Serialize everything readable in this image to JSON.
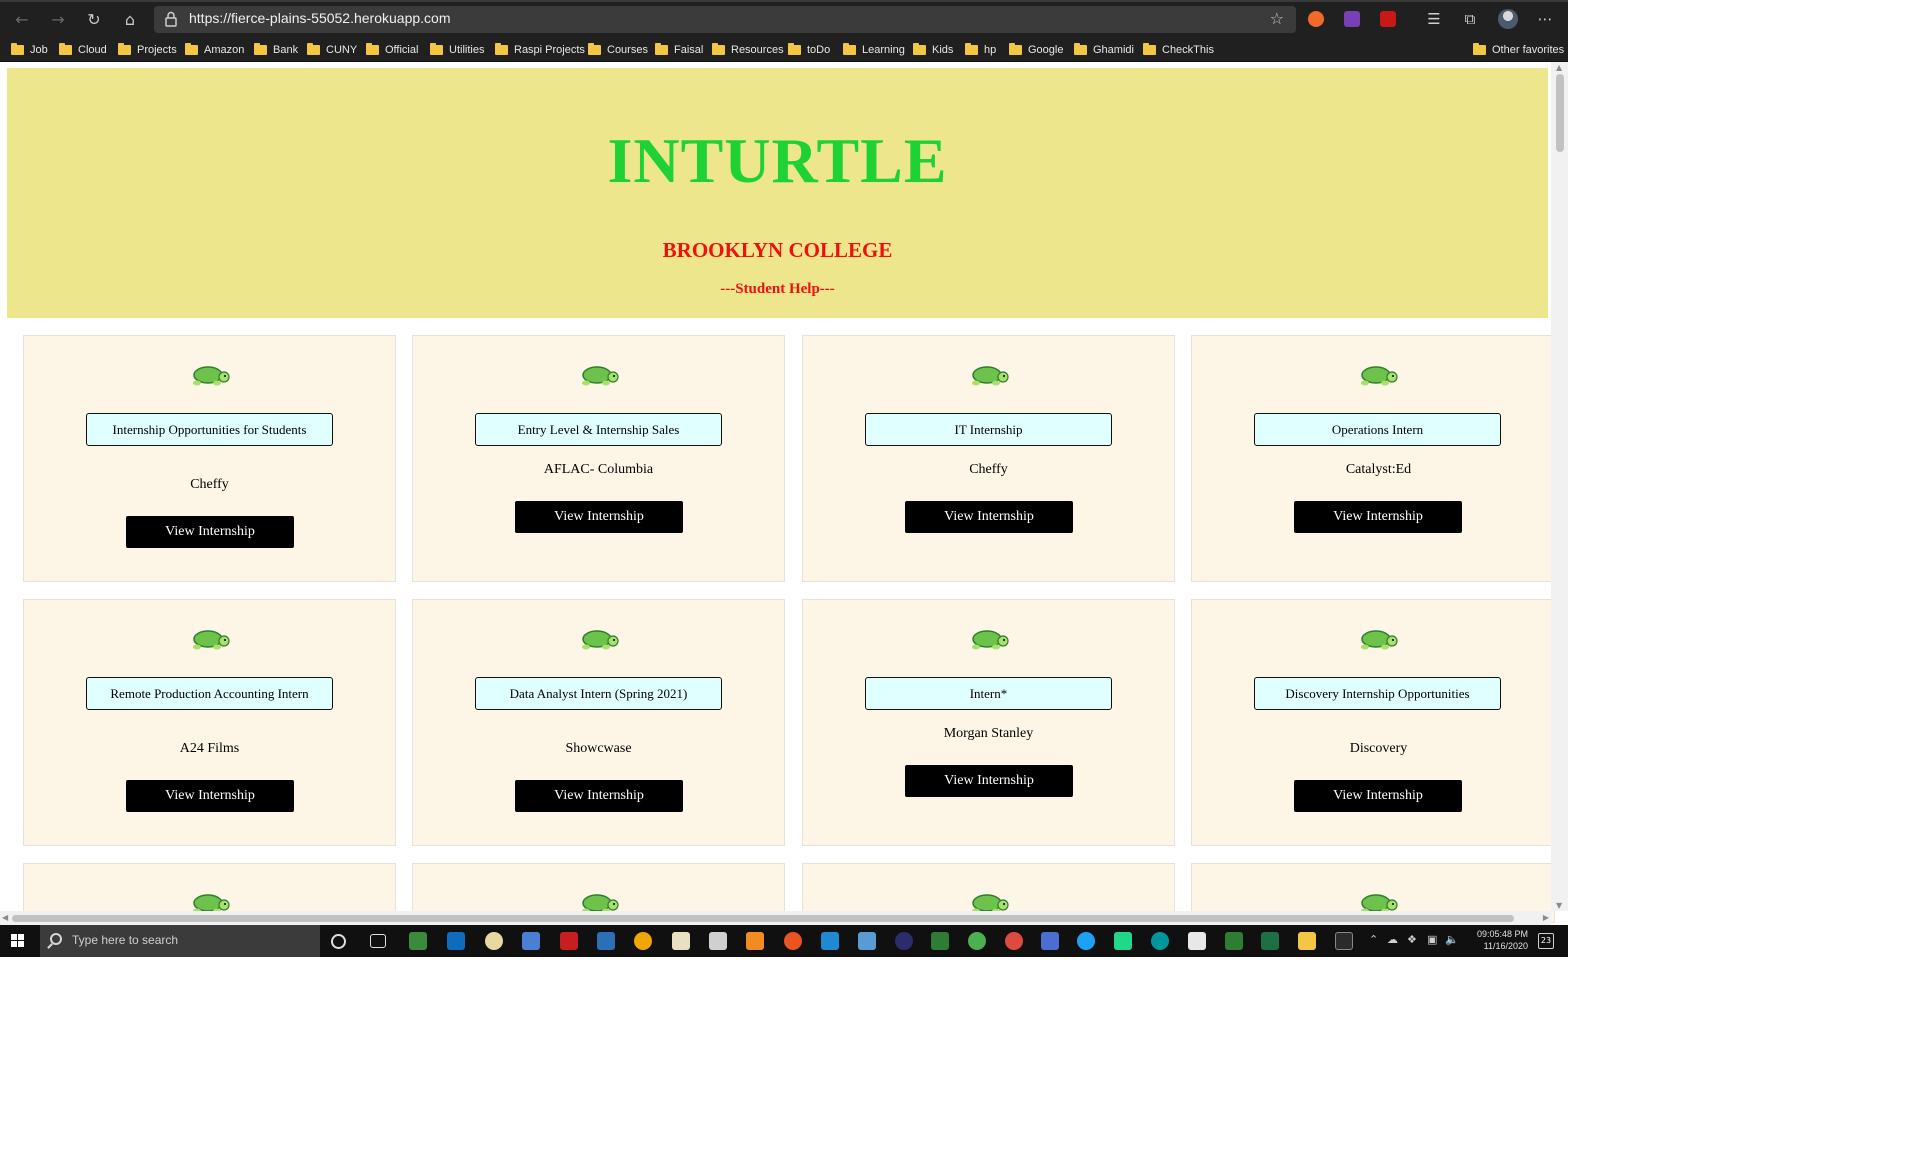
{
  "browser": {
    "url": "https://fierce-plains-55052.herokuapp.com",
    "bookmarks": [
      "Job",
      "Cloud",
      "Projects",
      "Amazon",
      "Bank",
      "CUNY",
      "Official",
      "Utilities",
      "Raspi Projects",
      "Courses",
      "Faisal",
      "Resources",
      "toDo",
      "Learning",
      "Kids",
      "hp",
      "Google",
      "Ghamidi",
      "CheckThis"
    ],
    "other_favorites": "Other favorites"
  },
  "page": {
    "title": "INTURTLE",
    "subtitle": "BROOKLYN COLLEGE",
    "tagline": "---Student Help---",
    "title_color": "#1ed235",
    "subtitle_color": "#ee1111",
    "header_bg": "#eee68c",
    "card_bg": "#fdf5e6",
    "title_box_bg": "#e0ffff",
    "button_label": "View Internship"
  },
  "cards": [
    {
      "title": "Internship Opportunities for Students",
      "company": "Cheffy"
    },
    {
      "title": "Entry Level & Internship Sales",
      "company": "AFLAC- Columbia"
    },
    {
      "title": "IT Internship",
      "company": "Cheffy"
    },
    {
      "title": "Operations Intern",
      "company": "Catalyst:Ed"
    },
    {
      "title": "Remote Production Accounting Intern",
      "company": "A24 Films"
    },
    {
      "title": "Data Analyst Intern (Spring 2021)",
      "company": "Showcwase"
    },
    {
      "title": "Intern*",
      "company": "Morgan Stanley"
    },
    {
      "title": "Discovery Internship Opportunities",
      "company": "Discovery"
    }
  ],
  "taskbar": {
    "search_placeholder": "Type here to search",
    "time": "09:05:48 PM",
    "date": "11/16/2020",
    "notification_count": "23"
  }
}
